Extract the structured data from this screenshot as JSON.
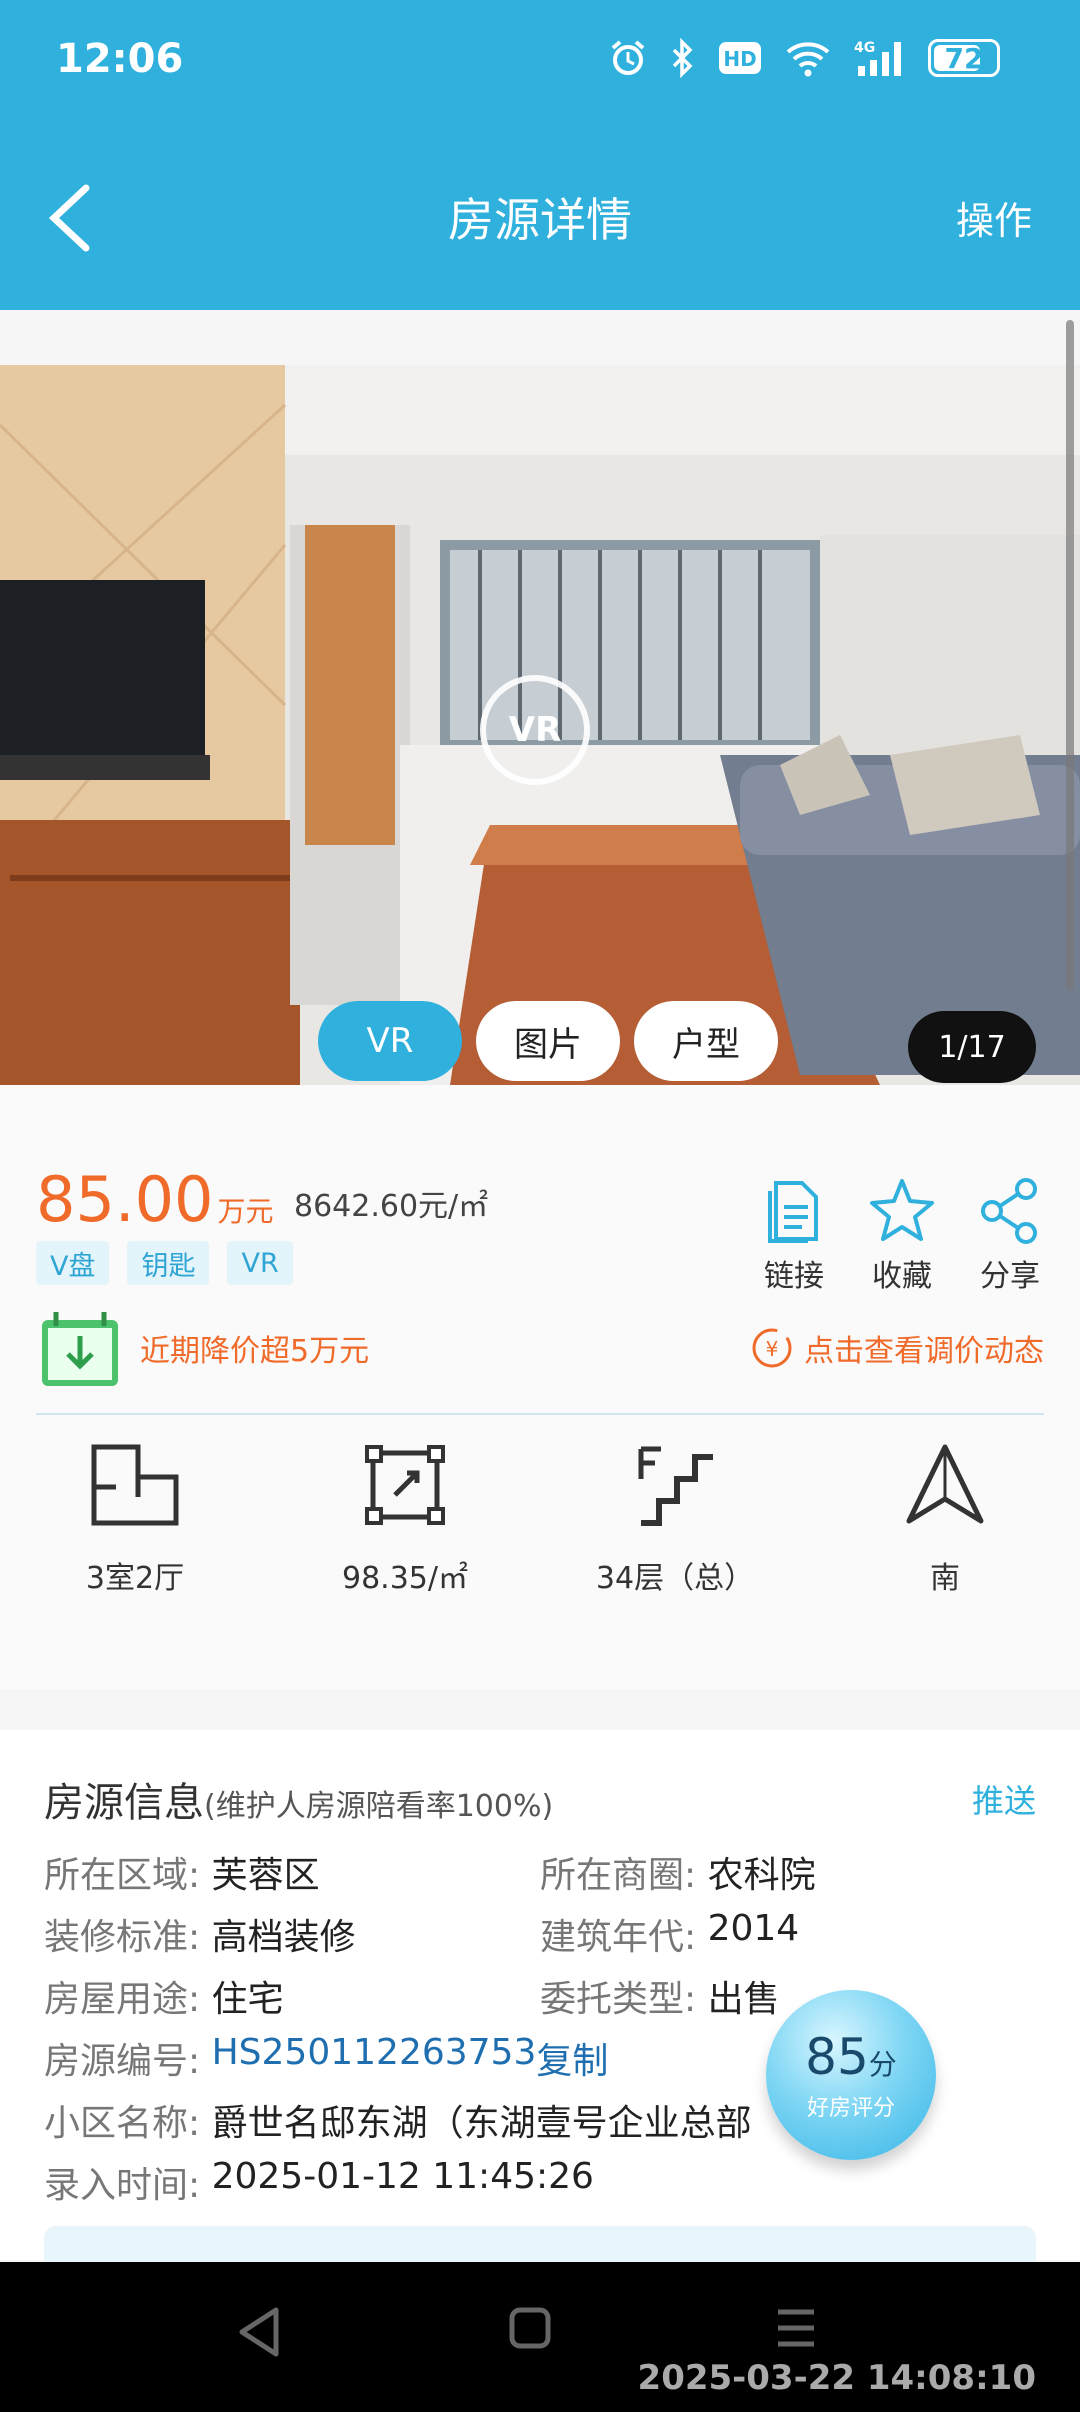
{
  "status_bar": {
    "time": "12:06",
    "battery": "72",
    "network": "4G",
    "hd": "HD"
  },
  "nav": {
    "title": "房源详情",
    "action": "操作"
  },
  "gallery": {
    "vr_badge": "VR",
    "tabs": [
      {
        "label": "VR",
        "active": true
      },
      {
        "label": "图片",
        "active": false
      },
      {
        "label": "户型",
        "active": false
      }
    ],
    "counter": "1/17"
  },
  "price": {
    "total": "85.00",
    "total_unit": "万元",
    "unit_price": "8642.60元/㎡",
    "tags": [
      "V盘",
      "钥匙",
      "VR"
    ],
    "actions": [
      {
        "label": "链接",
        "icon": "document-icon"
      },
      {
        "label": "收藏",
        "icon": "star-icon"
      },
      {
        "label": "分享",
        "icon": "share-icon"
      }
    ],
    "promo_left": "近期降价超5万元",
    "promo_right": "点击查看调价动态"
  },
  "specs": [
    {
      "label": "3室2厅",
      "icon": "floorplan-icon"
    },
    {
      "label": "98.35/㎡",
      "icon": "area-icon"
    },
    {
      "label": "34层（总）",
      "icon": "stairs-icon"
    },
    {
      "label": "南",
      "icon": "direction-icon"
    }
  ],
  "info": {
    "title": "房源信息",
    "subtitle": "(维护人房源陪看率100%)",
    "push": "推送",
    "rows": [
      {
        "l1": "所在区域:",
        "v1": "芙蓉区",
        "l2": "所在商圈:",
        "v2": "农科院"
      },
      {
        "l1": "装修标准:",
        "v1": "高档装修",
        "l2": "建筑年代:",
        "v2": "2014"
      },
      {
        "l1": "房屋用途:",
        "v1": "住宅",
        "l2": "委托类型:",
        "v2": "出售"
      }
    ],
    "code_label": "房源编号:",
    "code_value": "HS250112263753",
    "copy": "复制",
    "community_label": "小区名称:",
    "community_value": "爵世名邸东湖（东湖壹号企业总部",
    "entry_label": "录入时间:",
    "entry_value": "2025-01-12 11:45:26"
  },
  "score": {
    "value": "85",
    "unit": "分",
    "label": "好房评分"
  },
  "watermark_timestamp": "2025-03-22 14:08:10",
  "colors": {
    "brand": "#2fb0dd",
    "price": "#f06a2a",
    "link": "#1f6fb0"
  }
}
